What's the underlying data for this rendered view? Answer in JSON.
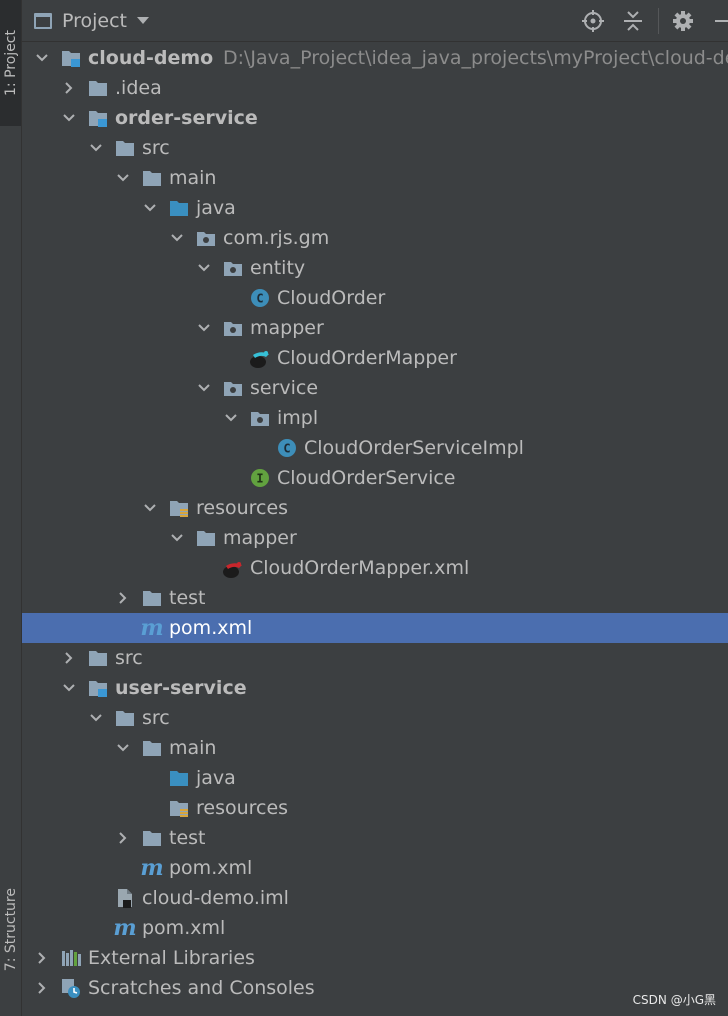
{
  "sidebar": {
    "project_tab": "1: Project",
    "structure_tab": "7: Structure"
  },
  "header": {
    "title": "Project"
  },
  "colors": {
    "background": "#3c3f41",
    "selection": "#4b6eaf",
    "folder": "#8fa4b6",
    "source_folder": "#3a8fc0",
    "class_icon": "#3d8eb9",
    "interface_icon": "#62a23f",
    "maven": "#5a9fd4"
  },
  "tree": [
    {
      "label": "cloud-demo",
      "path": "D:\\Java_Project\\idea_java_projects\\myProject\\cloud-demo",
      "indent": 0,
      "arrow": "down",
      "icon": "module-icon",
      "bold": true
    },
    {
      "label": ".idea",
      "indent": 1,
      "arrow": "right",
      "icon": "folder-icon"
    },
    {
      "label": "order-service",
      "indent": 1,
      "arrow": "down",
      "icon": "module-icon",
      "bold": true
    },
    {
      "label": "src",
      "indent": 2,
      "arrow": "down",
      "icon": "folder-icon"
    },
    {
      "label": "main",
      "indent": 3,
      "arrow": "down",
      "icon": "folder-icon"
    },
    {
      "label": "java",
      "indent": 4,
      "arrow": "down",
      "icon": "source-folder-icon"
    },
    {
      "label": "com.rjs.gm",
      "indent": 5,
      "arrow": "down",
      "icon": "package-icon"
    },
    {
      "label": "entity",
      "indent": 6,
      "arrow": "down",
      "icon": "package-icon"
    },
    {
      "label": "CloudOrder",
      "indent": 7,
      "arrow": "none",
      "icon": "class-icon"
    },
    {
      "label": "mapper",
      "indent": 6,
      "arrow": "down",
      "icon": "package-icon"
    },
    {
      "label": "CloudOrderMapper",
      "indent": 7,
      "arrow": "none",
      "icon": "mybatis-icon"
    },
    {
      "label": "service",
      "indent": 6,
      "arrow": "down",
      "icon": "package-icon"
    },
    {
      "label": "impl",
      "indent": 7,
      "arrow": "down",
      "icon": "package-icon"
    },
    {
      "label": "CloudOrderServiceImpl",
      "indent": 8,
      "arrow": "none",
      "icon": "class-icon"
    },
    {
      "label": "CloudOrderService",
      "indent": 7,
      "arrow": "none",
      "icon": "interface-icon"
    },
    {
      "label": "resources",
      "indent": 4,
      "arrow": "down",
      "icon": "resources-folder-icon"
    },
    {
      "label": "mapper",
      "indent": 5,
      "arrow": "down",
      "icon": "folder-icon"
    },
    {
      "label": "CloudOrderMapper.xml",
      "indent": 6,
      "arrow": "none",
      "icon": "mybatis-xml-icon"
    },
    {
      "label": "test",
      "indent": 3,
      "arrow": "right",
      "icon": "folder-icon"
    },
    {
      "label": "pom.xml",
      "indent": 3,
      "arrow": "none",
      "icon": "maven-icon",
      "selected": true
    },
    {
      "label": "src",
      "indent": 1,
      "arrow": "right",
      "icon": "folder-icon"
    },
    {
      "label": "user-service",
      "indent": 1,
      "arrow": "down",
      "icon": "module-icon",
      "bold": true
    },
    {
      "label": "src",
      "indent": 2,
      "arrow": "down",
      "icon": "folder-icon"
    },
    {
      "label": "main",
      "indent": 3,
      "arrow": "down",
      "icon": "folder-icon"
    },
    {
      "label": "java",
      "indent": 4,
      "arrow": "none",
      "icon": "source-folder-icon"
    },
    {
      "label": "resources",
      "indent": 4,
      "arrow": "none",
      "icon": "resources-folder-icon"
    },
    {
      "label": "test",
      "indent": 3,
      "arrow": "right",
      "icon": "folder-icon"
    },
    {
      "label": "pom.xml",
      "indent": 3,
      "arrow": "none",
      "icon": "maven-icon"
    },
    {
      "label": "cloud-demo.iml",
      "indent": 2,
      "arrow": "none",
      "icon": "iml-file-icon"
    },
    {
      "label": "pom.xml",
      "indent": 2,
      "arrow": "none",
      "icon": "maven-icon"
    },
    {
      "label": "External Libraries",
      "indent": 0,
      "arrow": "right",
      "icon": "libraries-icon"
    },
    {
      "label": "Scratches and Consoles",
      "indent": 0,
      "arrow": "right",
      "icon": "scratches-icon"
    }
  ],
  "watermark": "CSDN @小G黑"
}
